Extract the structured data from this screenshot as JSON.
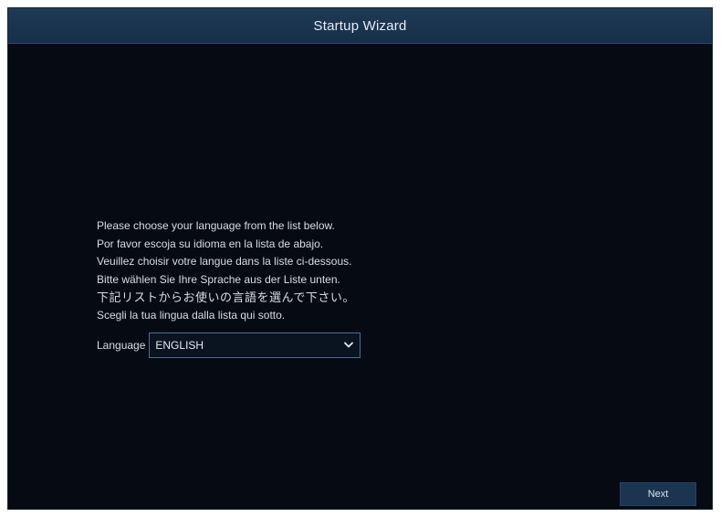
{
  "window": {
    "title": "Startup Wizard"
  },
  "instructions": [
    "Please choose your language from the list below.",
    "Por favor escoja su idioma en la lista de abajo.",
    "Veuillez choisir votre langue dans la liste ci-dessous.",
    "Bitte wählen Sie Ihre Sprache aus der Liste unten.",
    "下記リストからお使いの言語を選んで下さい。",
    "Scegli la tua lingua dalla lista qui sotto."
  ],
  "language": {
    "label": "Language",
    "selected": "ENGLISH"
  },
  "footer": {
    "next_label": "Next"
  },
  "colors": {
    "background": "#050a13",
    "titlebar": "#1f3a57",
    "button": "#1b3450",
    "select_border": "#4b6f99"
  },
  "icons": {
    "dropdown": "chevron-down-icon"
  }
}
